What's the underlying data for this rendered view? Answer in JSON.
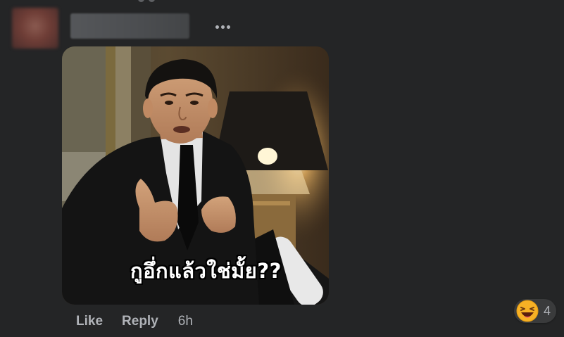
{
  "comment": {
    "author_name": "",
    "more_icon": "ellipsis-horizontal-icon"
  },
  "meme": {
    "caption": "กูอึ่กแล้วใช่มั้ย??"
  },
  "actions": {
    "like_label": "Like",
    "reply_label": "Reply",
    "timestamp": "6h"
  },
  "reactions": {
    "icon": "laughing-face-icon",
    "count": "4"
  },
  "colors": {
    "background": "#242526",
    "secondary_text": "#b0b3b8",
    "pill_background": "#3a3b3c",
    "reaction_yellow": "#f7b125"
  }
}
